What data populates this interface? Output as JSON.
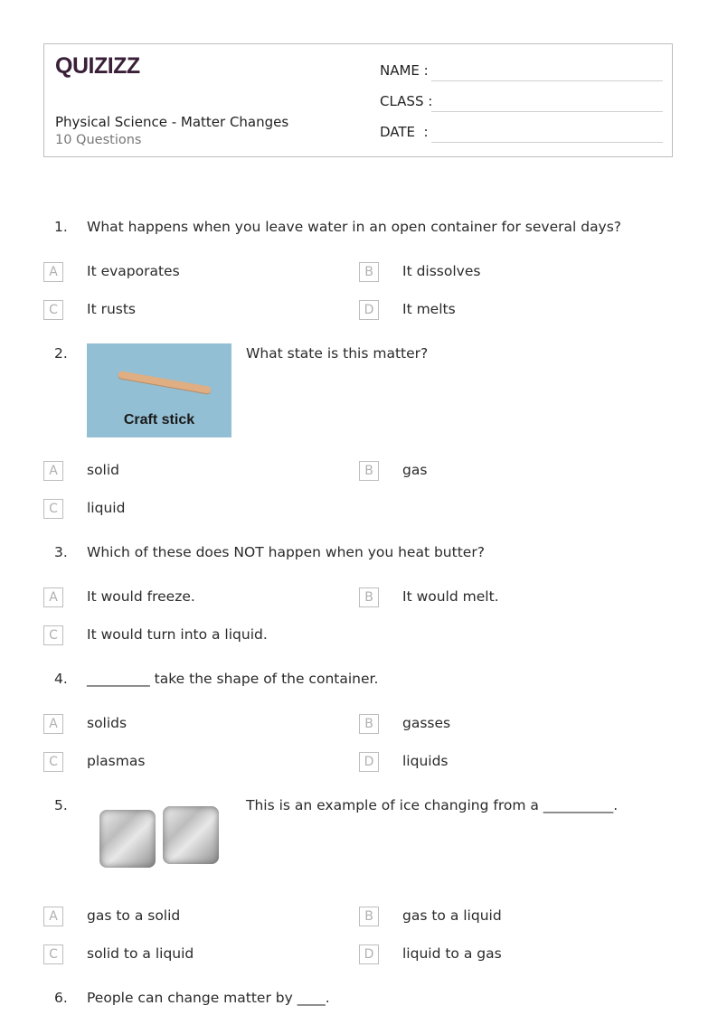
{
  "header": {
    "logo": "QUIZIZZ",
    "title": "Physical Science - Matter Changes",
    "count": "10 Questions",
    "fields": {
      "name": "NAME :",
      "class": "CLASS :",
      "date": "DATE  :"
    }
  },
  "questions": [
    {
      "number": "1.",
      "text": "What happens when you leave water in an open container for several days?",
      "options": [
        {
          "letter": "A",
          "text": "It evaporates"
        },
        {
          "letter": "B",
          "text": "It dissolves"
        },
        {
          "letter": "C",
          "text": "It rusts"
        },
        {
          "letter": "D",
          "text": "It melts"
        }
      ]
    },
    {
      "number": "2.",
      "text": "What state is this matter?",
      "image_label": "Craft stick",
      "options": [
        {
          "letter": "A",
          "text": "solid"
        },
        {
          "letter": "B",
          "text": "gas"
        },
        {
          "letter": "C",
          "text": "liquid"
        }
      ]
    },
    {
      "number": "3.",
      "text": "Which of these does NOT happen when you heat butter?",
      "options": [
        {
          "letter": "A",
          "text": "It would freeze."
        },
        {
          "letter": "B",
          "text": "It would melt."
        },
        {
          "letter": "C",
          "text": "It would turn into a liquid."
        }
      ]
    },
    {
      "number": "4.",
      "text": "_________ take the shape of the container.",
      "options": [
        {
          "letter": "A",
          "text": "solids"
        },
        {
          "letter": "B",
          "text": "gasses"
        },
        {
          "letter": "C",
          "text": "plasmas"
        },
        {
          "letter": "D",
          "text": "liquids"
        }
      ]
    },
    {
      "number": "5.",
      "text": "This is an example of ice changing from a __________.",
      "image_label": "ice cubes",
      "options": [
        {
          "letter": "A",
          "text": "gas to a solid"
        },
        {
          "letter": "B",
          "text": "gas to a liquid"
        },
        {
          "letter": "C",
          "text": "solid to a liquid"
        },
        {
          "letter": "D",
          "text": "liquid to a gas"
        }
      ]
    },
    {
      "number": "6.",
      "text": "People can change matter by ____."
    }
  ]
}
